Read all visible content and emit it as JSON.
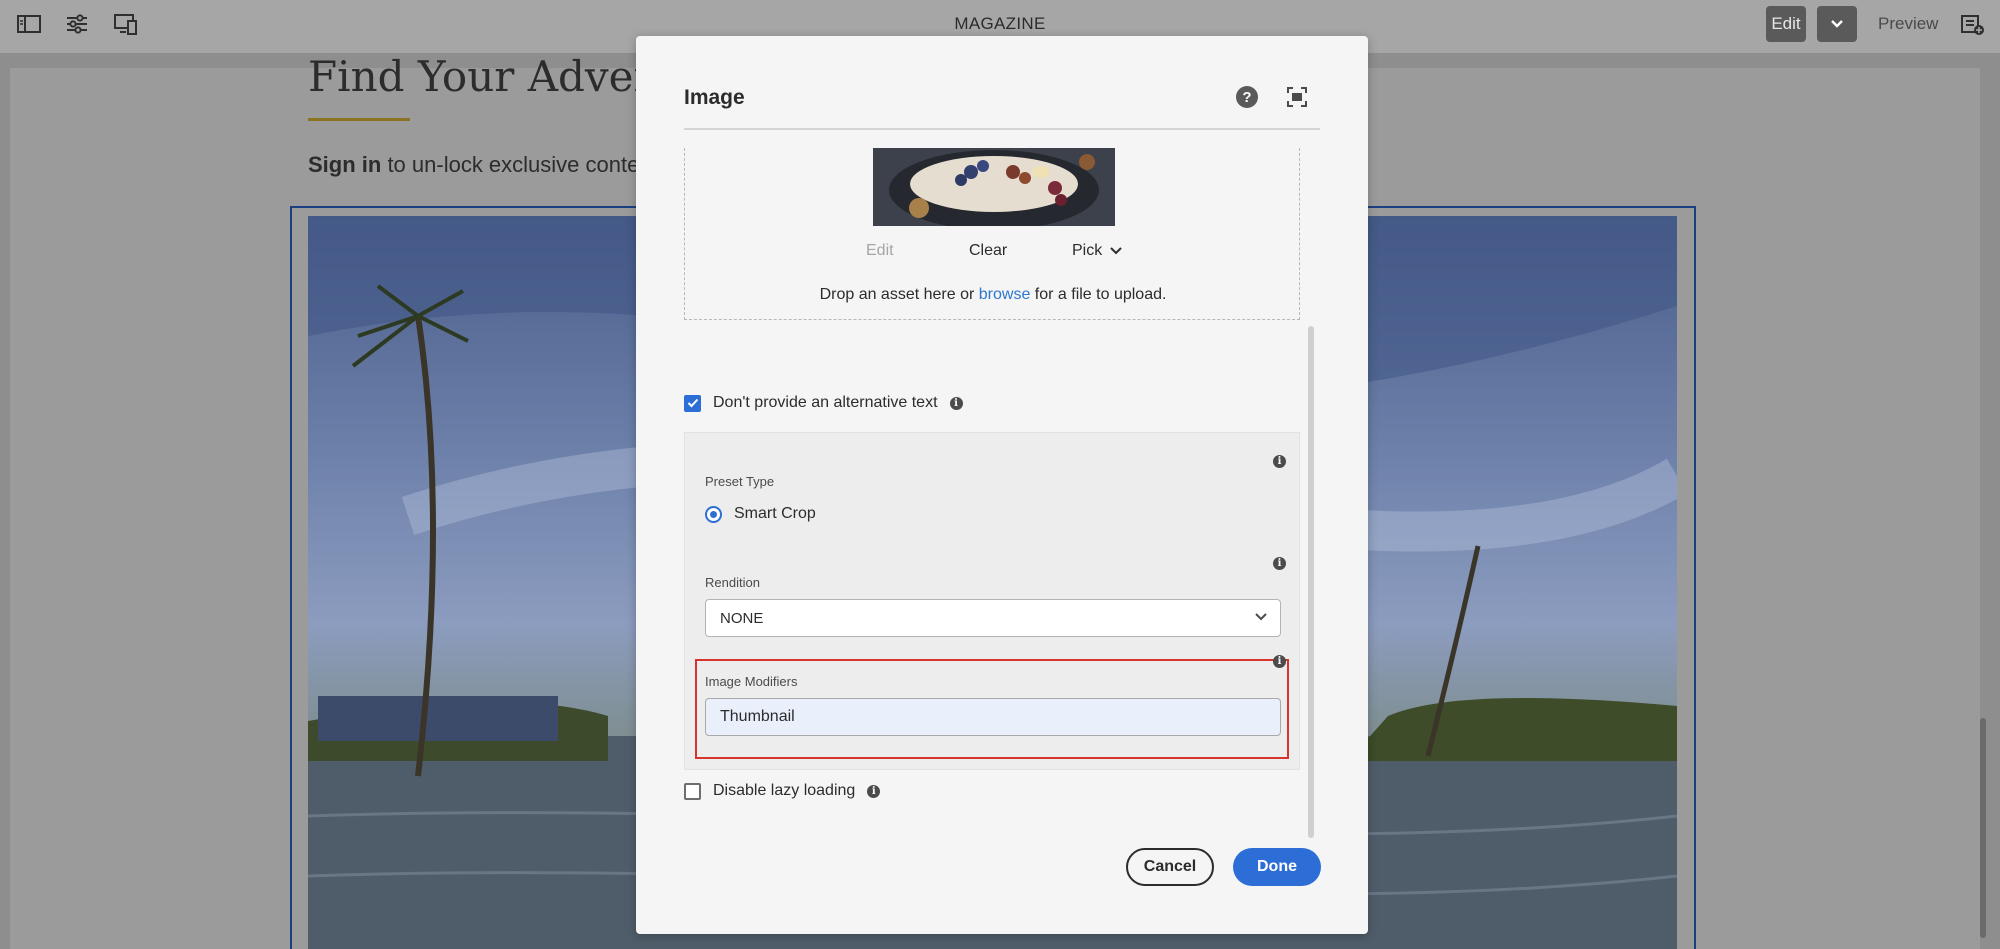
{
  "topbar": {
    "title": "MAGAZINE",
    "edit_label": "Edit",
    "preview_label": "Preview",
    "icons": [
      "side-panel-icon",
      "properties-icon",
      "emulator-icon",
      "chevron-down-icon",
      "annotation-icon"
    ]
  },
  "page": {
    "heading": "Find Your Adventu",
    "signin_bold": "Sign in",
    "signin_rest": " to un-lock exclusive content t"
  },
  "dialog": {
    "title": "Image",
    "help_icon": "help-icon",
    "fullscreen_icon": "fullscreen-icon",
    "asset": {
      "edit_label": "Edit",
      "clear_label": "Clear",
      "pick_label": "Pick",
      "drop_prefix": "Drop an asset here or ",
      "drop_link": "browse",
      "drop_suffix": " for a file to upload."
    },
    "alt_text": {
      "label": "Don't provide an alternative text",
      "checked": true
    },
    "preset_type": {
      "label": "Preset Type",
      "option": "Smart Crop",
      "selected": true
    },
    "rendition": {
      "label": "Rendition",
      "value": "NONE"
    },
    "image_modifiers": {
      "label": "Image Modifiers",
      "value": "Thumbnail"
    },
    "lazy_loading": {
      "label": "Disable lazy loading",
      "checked": false
    },
    "cancel_label": "Cancel",
    "done_label": "Done"
  },
  "colors": {
    "accent": "#2c6ed5",
    "highlight": "#d9332e",
    "link": "#2d78cf"
  }
}
